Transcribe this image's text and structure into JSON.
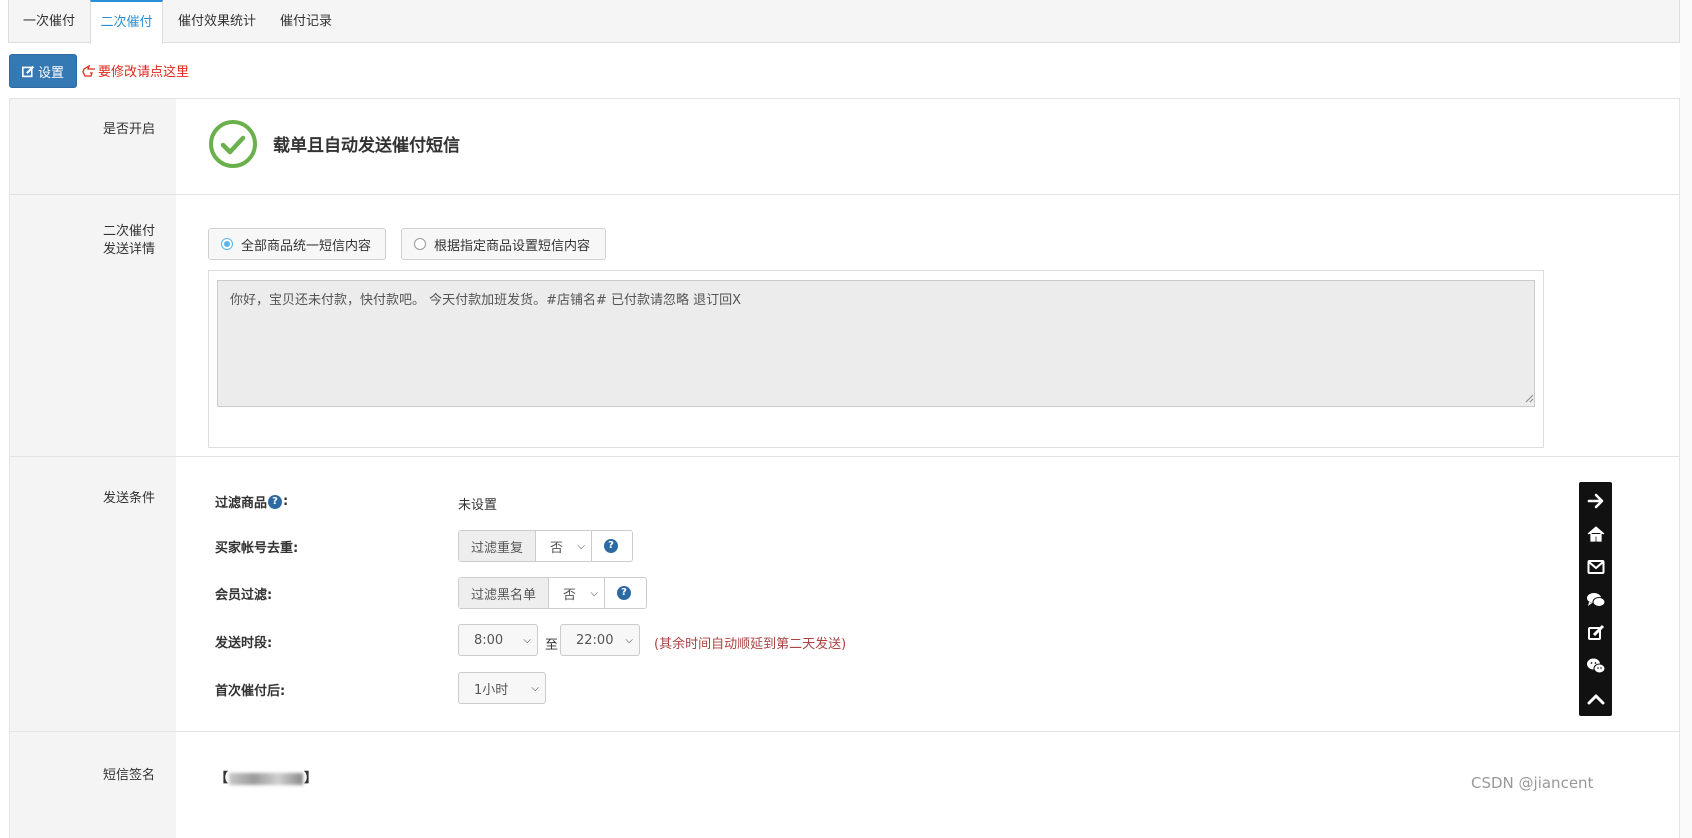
{
  "tabs": [
    {
      "label": "一次催付"
    },
    {
      "label": "二次催付"
    },
    {
      "label": "催付效果统计"
    },
    {
      "label": "催付记录"
    }
  ],
  "toolbar": {
    "settings_label": "设置",
    "hint_text": "要修改请点这里"
  },
  "rows": {
    "enabled_label": "是否开启",
    "enabled_text": "载单且自动发送催付短信",
    "detail_label_line1": "二次催付",
    "detail_label_line2": "发送详情",
    "radio_all": "全部商品统一短信内容",
    "radio_specific": "根据指定商品设置短信内容",
    "message_text": "你好，宝贝还未付款，快付款吧。 今天付款加班发货。#店铺名# 已付款请忽略 退订回X",
    "conditions_label": "发送条件",
    "signature_label": "短信签名"
  },
  "conditions": {
    "filter_goods_label": "过滤商品",
    "filter_goods_value": "未设置",
    "dedupe_label": "买家帐号去重:",
    "dedupe_addon": "过滤重复",
    "dedupe_value": "否",
    "member_label": "会员过滤:",
    "member_addon": "过滤黑名单",
    "member_value": "否",
    "period_label": "发送时段:",
    "period_start": "8:00",
    "period_to": "至",
    "period_end": "22:00",
    "period_note": "(其余时间自动顺延到第二天发送)",
    "after_label": "首次催付后:",
    "after_value": "1小时"
  },
  "signature": {
    "open_bracket": "【",
    "close_bracket": "】"
  },
  "sidebar_icons": [
    "arrow-right-icon",
    "home-icon",
    "envelope-icon",
    "chat-icon",
    "edit-icon",
    "wechat-icon",
    "chevron-up-icon"
  ],
  "watermark": "CSDN @jiancent",
  "colors": {
    "primary": "#3478b4",
    "active_tab": "#2a8fd6",
    "hint_red": "#e0291c",
    "success_green": "#6ab04c",
    "note_red": "#a94442"
  }
}
